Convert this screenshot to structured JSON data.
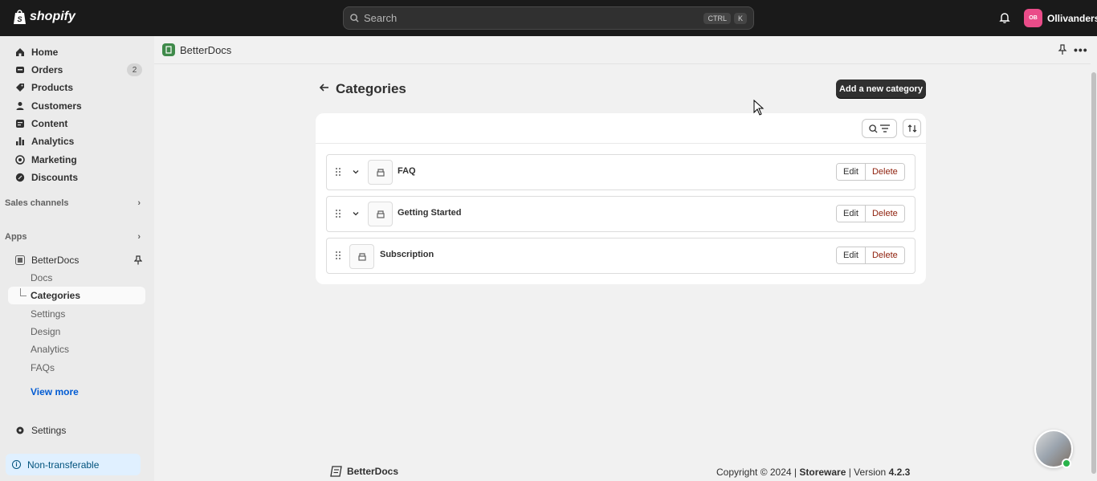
{
  "topbar": {
    "brand": "shopify",
    "search_placeholder": "Search",
    "shortcut_ctrl": "CTRL",
    "shortcut_k": "K",
    "store_initials": "OB",
    "store_name": "Ollivanders"
  },
  "sidebar": {
    "nav": [
      {
        "label": "Home",
        "icon": "home-icon"
      },
      {
        "label": "Orders",
        "icon": "orders-icon",
        "badge": "2"
      },
      {
        "label": "Products",
        "icon": "tag-icon"
      },
      {
        "label": "Customers",
        "icon": "person-icon"
      },
      {
        "label": "Content",
        "icon": "content-icon"
      },
      {
        "label": "Analytics",
        "icon": "bar-chart-icon"
      },
      {
        "label": "Marketing",
        "icon": "target-icon"
      },
      {
        "label": "Discounts",
        "icon": "discount-icon"
      }
    ],
    "sales_channels": "Sales channels",
    "apps": "Apps",
    "app_name": "BetterDocs",
    "app_sub": [
      "Docs",
      "Categories",
      "Settings",
      "Design",
      "Analytics",
      "FAQs"
    ],
    "view_more": "View more",
    "settings": "Settings",
    "non_transferable": "Non-transferable"
  },
  "appbar": {
    "title": "BetterDocs"
  },
  "page": {
    "title": "Categories",
    "add_button": "Add a new category",
    "categories": [
      {
        "name": "FAQ",
        "expandable": true
      },
      {
        "name": "Getting Started",
        "expandable": true
      },
      {
        "name": "Subscription",
        "expandable": false
      }
    ],
    "edit_label": "Edit",
    "delete_label": "Delete"
  },
  "footer": {
    "brand": "BetterDocs",
    "copyright": "Copyright © 2024 |",
    "company": "Storeware",
    "version_label": "| Version",
    "version": "4.2.3"
  },
  "colors": {
    "topbar": "#1a1a1a",
    "primary_button": "#303030",
    "delete_text": "#8e1f0b",
    "link": "#005bd3",
    "store_avatar": "#ea4c89",
    "app_icon": "#3f8a4a"
  }
}
